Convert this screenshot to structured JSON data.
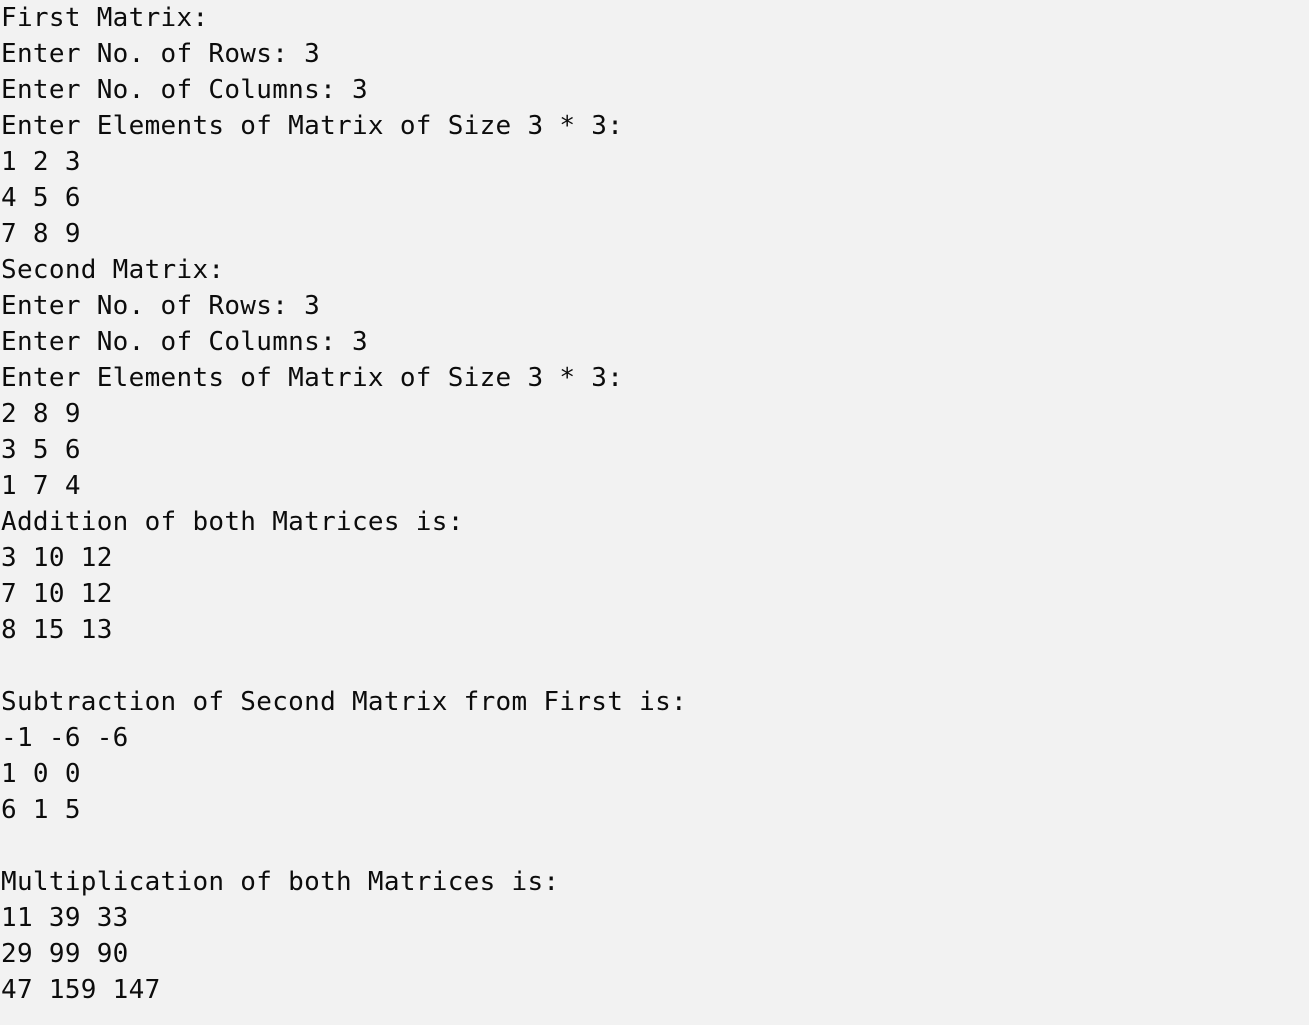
{
  "console": {
    "lines": [
      "First Matrix:",
      "Enter No. of Rows: 3",
      "Enter No. of Columns: 3",
      "Enter Elements of Matrix of Size 3 * 3:",
      "1 2 3",
      "4 5 6",
      "7 8 9",
      "Second Matrix:",
      "Enter No. of Rows: 3",
      "Enter No. of Columns: 3",
      "Enter Elements of Matrix of Size 3 * 3:",
      "2 8 9",
      "3 5 6",
      "1 7 4",
      "Addition of both Matrices is:",
      "3 10 12",
      "7 10 12",
      "8 15 13",
      "",
      "Subtraction of Second Matrix from First is:",
      "-1 -6 -6",
      "1 0 0",
      "6 1 5",
      "",
      "Multiplication of both Matrices is:",
      "11 39 33",
      "29 99 90",
      "47 159 147"
    ]
  }
}
